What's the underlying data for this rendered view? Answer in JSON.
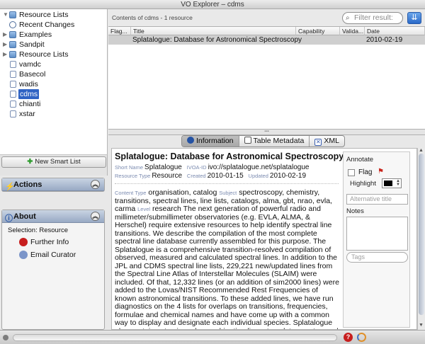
{
  "window": {
    "title": "VO Explorer – cdms"
  },
  "sidebar": {
    "header": "Resource Lists",
    "items": [
      {
        "label": "Recent Changes",
        "icon": "clock-icon"
      },
      {
        "label": "Examples",
        "icon": "folder-icon"
      },
      {
        "label": "Sandpit",
        "icon": "folder-icon"
      },
      {
        "label": "Resource Lists",
        "icon": "folder-icon"
      },
      {
        "label": "vamdc",
        "icon": "document-icon"
      },
      {
        "label": "Basecol",
        "icon": "document-icon"
      },
      {
        "label": "wadis",
        "icon": "document-icon"
      },
      {
        "label": "cdms",
        "icon": "document-icon",
        "selected": true
      },
      {
        "label": "chianti",
        "icon": "document-icon"
      },
      {
        "label": "xstar",
        "icon": "document-icon"
      }
    ],
    "new_smart_list": "New Smart List"
  },
  "actions": {
    "title": "Actions"
  },
  "about": {
    "title": "About",
    "selection": "Selection: Resource",
    "further_info": "Further Info",
    "email_curator": "Email Curator"
  },
  "content": {
    "caption": "Contents of cdms - 1 resource",
    "filter_placeholder": "Filter result:",
    "columns": [
      "Flag...",
      "Title",
      "Capability",
      "Valida...",
      "Date"
    ],
    "rows": [
      {
        "flag": "",
        "title": "Splatalogue: Database for Astronomical Spectroscopy",
        "capability": "",
        "validation": "",
        "date": "2010-02-19"
      }
    ]
  },
  "tabs": [
    "Information",
    "Table Metadata",
    "XML"
  ],
  "detail": {
    "title": "Splatalogue: Database for Astronomical Spectroscopy",
    "short_name_key": "Short Name",
    "short_name": "Splatalogue",
    "ivoa_key": "IVOA-ID",
    "ivoa_id": "ivo://splatalogue.net/splatalogue",
    "type_key": "Resource Type",
    "type": "Resource",
    "created_key": "Created",
    "created": "2010-01-15",
    "updated_key": "Updated",
    "updated": "2010-02-19",
    "content_type_key": "Content Type",
    "content_type": "organisation, catalog",
    "subject_key": "Subject",
    "subject": "spectroscopy, chemistry, transitions, spectral lines, line lists, catalogs, alma, gbt, nrao, evla, carma",
    "level_key": "Level",
    "level": "research",
    "description": "The next generation of powerful radio and millimeter/submillimeter observatories (e.g. EVLA, ALMA, & Herschel) require extensive resources to help identify spectral line transitions. We describe the compilation of the most complete spectral line database currently assembled for this purpose. The Splatalogue is a comprehensive transition-resolved compilation of observed, measured and calculated spectral lines. In addition to the JPL and CDMS spectral line lists, 229,221 new/updated lines from the Spectral Line Atlas of Interstellar Molecules (SLAIM) were included. Of that, 12,332 lines (or an addition of sim2000 lines) were added to the Lovas/NIST Recommended Rest Frequencies of known astronomical transitions. To these added lines, we have run diagnostics on the 4 lists for overlaps on transitions, frequencies, formulae and chemical names and have come up with a common way to display and designate each individual species. Splatalogue also contains atomic and recombination lines, template spectra, and is completely VO-compliant, queryable under the IVOA SLAP standard. In this presentation, I will describe the latest status of the database and a short demonstration of its"
  },
  "annotate": {
    "title": "Annotate",
    "flag": "Flag",
    "highlight": "Highlight",
    "alt_placeholder": "Alternative title",
    "notes": "Notes",
    "tags_placeholder": "Tags"
  }
}
